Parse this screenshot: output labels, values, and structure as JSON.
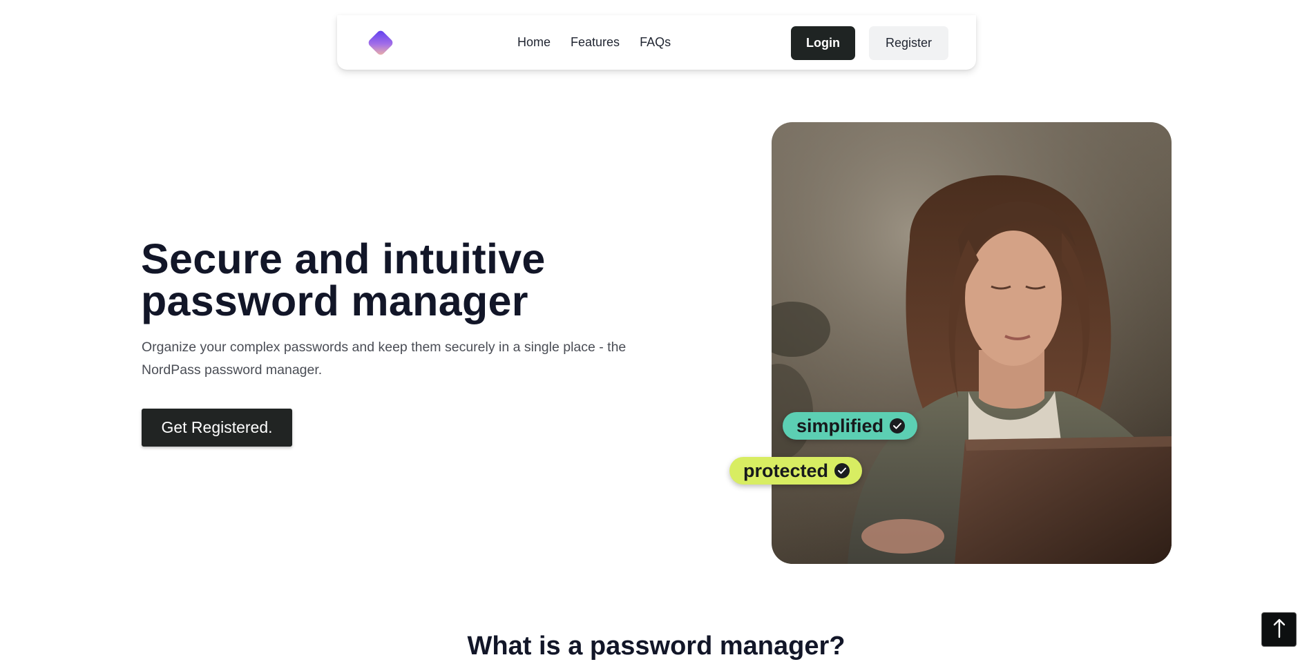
{
  "nav": {
    "logo_icon": "gradient-diamond-logo",
    "links": [
      "Home",
      "Features",
      "FAQs"
    ],
    "login_label": "Login",
    "register_label": "Register"
  },
  "hero": {
    "title_line1": "Secure and intuitive",
    "title_line2": "password manager",
    "subtitle_line1": "Organize your complex passwords and keep them securely in a single place - the",
    "subtitle_line2": "NordPass password manager.",
    "cta_label": "Get Registered.",
    "photo_icon": "woman-using-laptop-photo",
    "badges": [
      {
        "label": "simplified",
        "color": "#5ccfb3",
        "icon": "check-circle-icon"
      },
      {
        "label": "protected",
        "color": "#d8ed62",
        "icon": "check-circle-icon"
      }
    ]
  },
  "section": {
    "heading": "What is a password manager?"
  },
  "scroll_top": {
    "icon": "arrow-up-icon"
  },
  "colors": {
    "primary_button": "#1f2423",
    "secondary_button": "#f1f2f3",
    "heading": "#121628",
    "text_muted": "#4a4d55"
  }
}
